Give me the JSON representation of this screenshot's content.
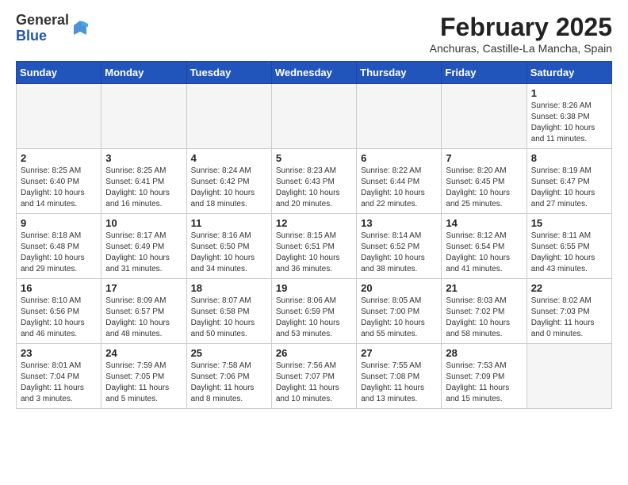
{
  "logo": {
    "general": "General",
    "blue": "Blue"
  },
  "title": {
    "month_year": "February 2025",
    "location": "Anchuras, Castille-La Mancha, Spain"
  },
  "weekdays": [
    "Sunday",
    "Monday",
    "Tuesday",
    "Wednesday",
    "Thursday",
    "Friday",
    "Saturday"
  ],
  "weeks": [
    [
      {
        "day": "",
        "info": ""
      },
      {
        "day": "",
        "info": ""
      },
      {
        "day": "",
        "info": ""
      },
      {
        "day": "",
        "info": ""
      },
      {
        "day": "",
        "info": ""
      },
      {
        "day": "",
        "info": ""
      },
      {
        "day": "1",
        "info": "Sunrise: 8:26 AM\nSunset: 6:38 PM\nDaylight: 10 hours\nand 11 minutes."
      }
    ],
    [
      {
        "day": "2",
        "info": "Sunrise: 8:25 AM\nSunset: 6:40 PM\nDaylight: 10 hours\nand 14 minutes."
      },
      {
        "day": "3",
        "info": "Sunrise: 8:25 AM\nSunset: 6:41 PM\nDaylight: 10 hours\nand 16 minutes."
      },
      {
        "day": "4",
        "info": "Sunrise: 8:24 AM\nSunset: 6:42 PM\nDaylight: 10 hours\nand 18 minutes."
      },
      {
        "day": "5",
        "info": "Sunrise: 8:23 AM\nSunset: 6:43 PM\nDaylight: 10 hours\nand 20 minutes."
      },
      {
        "day": "6",
        "info": "Sunrise: 8:22 AM\nSunset: 6:44 PM\nDaylight: 10 hours\nand 22 minutes."
      },
      {
        "day": "7",
        "info": "Sunrise: 8:20 AM\nSunset: 6:45 PM\nDaylight: 10 hours\nand 25 minutes."
      },
      {
        "day": "8",
        "info": "Sunrise: 8:19 AM\nSunset: 6:47 PM\nDaylight: 10 hours\nand 27 minutes."
      }
    ],
    [
      {
        "day": "9",
        "info": "Sunrise: 8:18 AM\nSunset: 6:48 PM\nDaylight: 10 hours\nand 29 minutes."
      },
      {
        "day": "10",
        "info": "Sunrise: 8:17 AM\nSunset: 6:49 PM\nDaylight: 10 hours\nand 31 minutes."
      },
      {
        "day": "11",
        "info": "Sunrise: 8:16 AM\nSunset: 6:50 PM\nDaylight: 10 hours\nand 34 minutes."
      },
      {
        "day": "12",
        "info": "Sunrise: 8:15 AM\nSunset: 6:51 PM\nDaylight: 10 hours\nand 36 minutes."
      },
      {
        "day": "13",
        "info": "Sunrise: 8:14 AM\nSunset: 6:52 PM\nDaylight: 10 hours\nand 38 minutes."
      },
      {
        "day": "14",
        "info": "Sunrise: 8:12 AM\nSunset: 6:54 PM\nDaylight: 10 hours\nand 41 minutes."
      },
      {
        "day": "15",
        "info": "Sunrise: 8:11 AM\nSunset: 6:55 PM\nDaylight: 10 hours\nand 43 minutes."
      }
    ],
    [
      {
        "day": "16",
        "info": "Sunrise: 8:10 AM\nSunset: 6:56 PM\nDaylight: 10 hours\nand 46 minutes."
      },
      {
        "day": "17",
        "info": "Sunrise: 8:09 AM\nSunset: 6:57 PM\nDaylight: 10 hours\nand 48 minutes."
      },
      {
        "day": "18",
        "info": "Sunrise: 8:07 AM\nSunset: 6:58 PM\nDaylight: 10 hours\nand 50 minutes."
      },
      {
        "day": "19",
        "info": "Sunrise: 8:06 AM\nSunset: 6:59 PM\nDaylight: 10 hours\nand 53 minutes."
      },
      {
        "day": "20",
        "info": "Sunrise: 8:05 AM\nSunset: 7:00 PM\nDaylight: 10 hours\nand 55 minutes."
      },
      {
        "day": "21",
        "info": "Sunrise: 8:03 AM\nSunset: 7:02 PM\nDaylight: 10 hours\nand 58 minutes."
      },
      {
        "day": "22",
        "info": "Sunrise: 8:02 AM\nSunset: 7:03 PM\nDaylight: 11 hours\nand 0 minutes."
      }
    ],
    [
      {
        "day": "23",
        "info": "Sunrise: 8:01 AM\nSunset: 7:04 PM\nDaylight: 11 hours\nand 3 minutes."
      },
      {
        "day": "24",
        "info": "Sunrise: 7:59 AM\nSunset: 7:05 PM\nDaylight: 11 hours\nand 5 minutes."
      },
      {
        "day": "25",
        "info": "Sunrise: 7:58 AM\nSunset: 7:06 PM\nDaylight: 11 hours\nand 8 minutes."
      },
      {
        "day": "26",
        "info": "Sunrise: 7:56 AM\nSunset: 7:07 PM\nDaylight: 11 hours\nand 10 minutes."
      },
      {
        "day": "27",
        "info": "Sunrise: 7:55 AM\nSunset: 7:08 PM\nDaylight: 11 hours\nand 13 minutes."
      },
      {
        "day": "28",
        "info": "Sunrise: 7:53 AM\nSunset: 7:09 PM\nDaylight: 11 hours\nand 15 minutes."
      },
      {
        "day": "",
        "info": ""
      }
    ]
  ]
}
